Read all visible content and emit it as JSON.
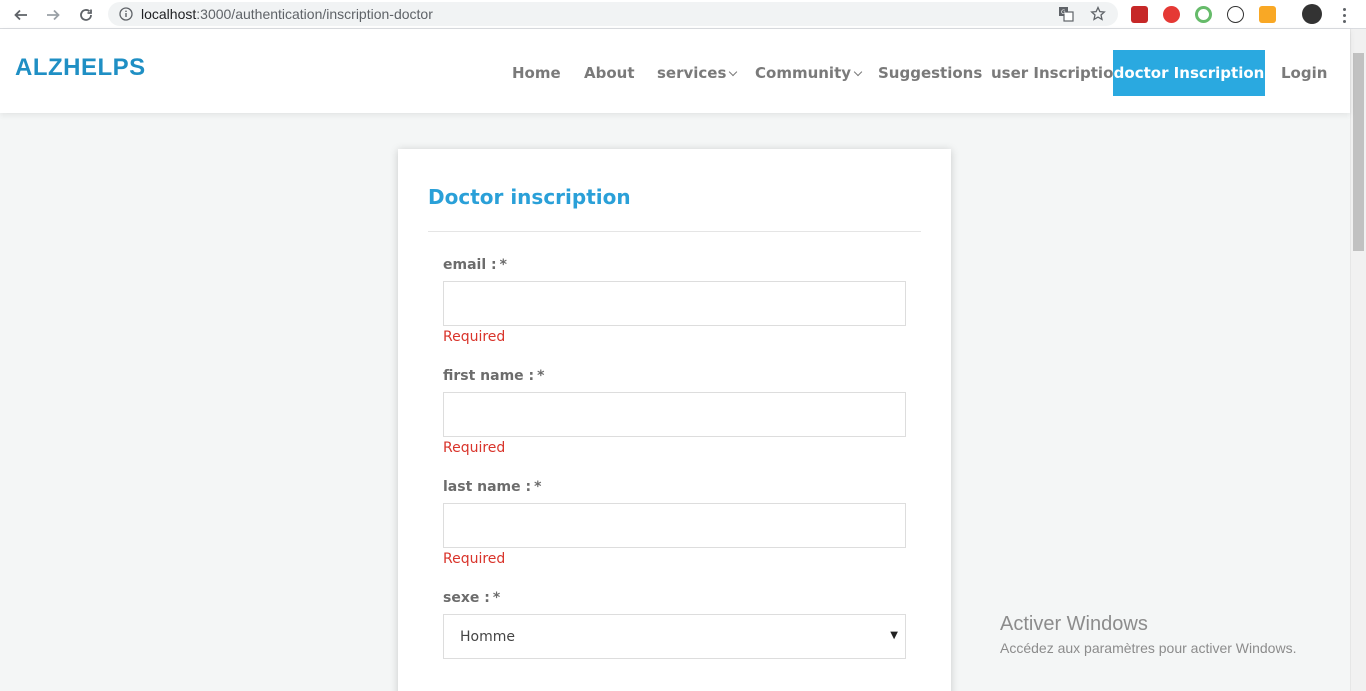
{
  "browser": {
    "url_host": "localhost",
    "url_path": ":3000/authentication/inscription-doctor"
  },
  "site": {
    "logo": "ALZHELPS",
    "nav": [
      {
        "label": "Home"
      },
      {
        "label": "About"
      },
      {
        "label": "services"
      },
      {
        "label": "Community"
      },
      {
        "label": "Suggestions"
      },
      {
        "label": "user Inscription"
      },
      {
        "label": "doctor Inscription"
      },
      {
        "label": "Login"
      }
    ]
  },
  "form": {
    "title": "Doctor inscription",
    "required_marker": "*",
    "fields": [
      {
        "label": "email :",
        "value": "",
        "error": "Required"
      },
      {
        "label": "first name :",
        "value": "",
        "error": "Required"
      },
      {
        "label": "last name :",
        "value": "",
        "error": "Required"
      },
      {
        "label": "sexe :",
        "selected": "Homme"
      }
    ]
  },
  "watermark": {
    "title": "Activer Windows",
    "subtitle": "Accédez aux paramètres pour activer Windows."
  },
  "colors": {
    "accent": "#2aa9e0",
    "error": "#d9342b",
    "logo": "#1f8fc4"
  }
}
